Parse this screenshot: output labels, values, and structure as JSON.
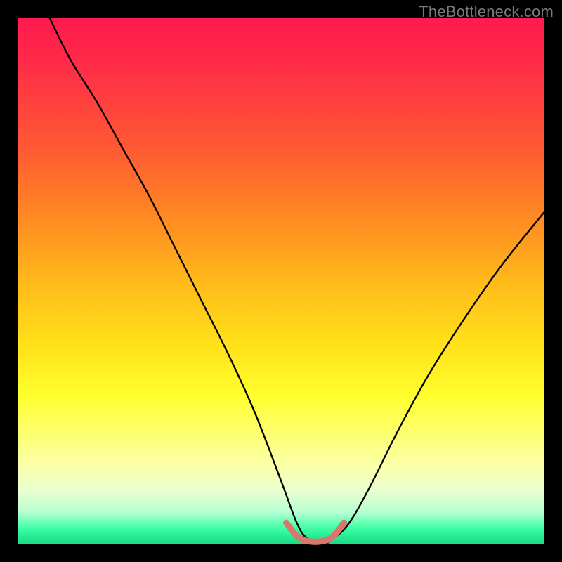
{
  "watermark": "TheBottleneck.com",
  "chart_data": {
    "type": "line",
    "title": "",
    "xlabel": "",
    "ylabel": "",
    "xlim": [
      0,
      100
    ],
    "ylim": [
      0,
      100
    ],
    "background_gradient": {
      "top": "#ff1a4f",
      "middle": "#ffe119",
      "bottom": "#1fd986",
      "meaning": "red (high bottleneck) → green (low bottleneck)"
    },
    "series": [
      {
        "name": "bottleneck-curve",
        "color": "#000000",
        "x": [
          6,
          10,
          15,
          20,
          25,
          30,
          35,
          40,
          45,
          50,
          53,
          55,
          58,
          60,
          63,
          67,
          72,
          78,
          85,
          92,
          100
        ],
        "values": [
          100,
          92,
          84,
          75,
          66,
          56,
          46,
          36,
          25,
          12,
          4,
          1,
          0,
          1,
          4,
          11,
          21,
          32,
          43,
          53,
          63
        ]
      },
      {
        "name": "optimal-range-marker",
        "color": "#d9776e",
        "x": [
          51,
          53,
          55,
          58,
          60,
          62
        ],
        "values": [
          4,
          1.5,
          0.5,
          0.5,
          1.5,
          4
        ]
      }
    ],
    "optimal_range": {
      "x_start": 51,
      "x_end": 62
    }
  }
}
